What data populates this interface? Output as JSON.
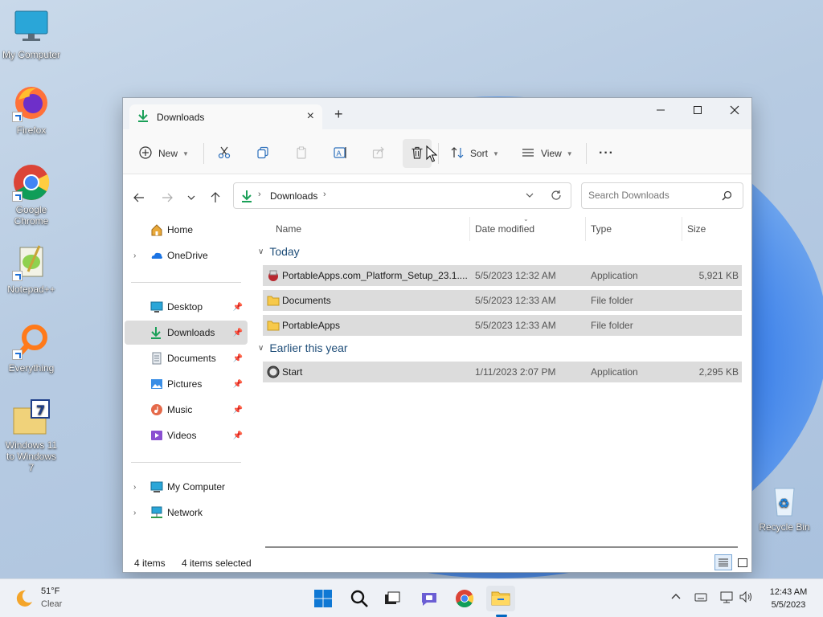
{
  "desktop": {
    "icons": [
      {
        "label": "My Computer"
      },
      {
        "label": "Firefox"
      },
      {
        "label": "Google Chrome"
      },
      {
        "label": "Notepad++"
      },
      {
        "label": "Everything"
      },
      {
        "label": "Windows 11 to Windows 7"
      },
      {
        "label": "Recycle Bin"
      }
    ]
  },
  "window": {
    "tab_title": "Downloads",
    "new_tab": "+",
    "toolbar": {
      "new_label": "New",
      "sort_label": "Sort",
      "view_label": "View",
      "more_label": "···"
    },
    "address": {
      "path": [
        "Downloads"
      ],
      "search_placeholder": "Search Downloads"
    },
    "nav": {
      "items": [
        {
          "label": "Home",
          "icon": "home-icon"
        },
        {
          "label": "OneDrive",
          "icon": "onedrive-icon"
        },
        {
          "label": "Desktop",
          "icon": "desktop-icon",
          "pinned": true
        },
        {
          "label": "Downloads",
          "icon": "downloads-icon",
          "pinned": true,
          "selected": true
        },
        {
          "label": "Documents",
          "icon": "documents-icon",
          "pinned": true
        },
        {
          "label": "Pictures",
          "icon": "pictures-icon",
          "pinned": true
        },
        {
          "label": "Music",
          "icon": "music-icon",
          "pinned": true
        },
        {
          "label": "Videos",
          "icon": "videos-icon",
          "pinned": true
        },
        {
          "label": "My Computer",
          "icon": "computer-icon"
        },
        {
          "label": "Network",
          "icon": "network-icon"
        }
      ]
    },
    "columns": [
      "Name",
      "Date modified",
      "Type",
      "Size"
    ],
    "groups": [
      {
        "label": "Today",
        "files": [
          {
            "name": "PortableApps.com_Platform_Setup_23.1....",
            "date": "5/5/2023 12:32 AM",
            "type": "Application",
            "size": "5,921 KB",
            "icon": "installer-icon"
          },
          {
            "name": "Documents",
            "date": "5/5/2023 12:33 AM",
            "type": "File folder",
            "size": "",
            "icon": "folder-icon"
          },
          {
            "name": "PortableApps",
            "date": "5/5/2023 12:33 AM",
            "type": "File folder",
            "size": "",
            "icon": "folder-icon"
          }
        ]
      },
      {
        "label": "Earlier this year",
        "files": [
          {
            "name": "Start",
            "date": "1/11/2023 2:07 PM",
            "type": "Application",
            "size": "2,295 KB",
            "icon": "start-app-icon"
          }
        ]
      }
    ],
    "status": {
      "item_count": "4 items",
      "selected_count": "4 items selected"
    }
  },
  "taskbar": {
    "weather_temp": "51°F",
    "weather_desc": "Clear",
    "time": "12:43 AM",
    "date": "5/5/2023"
  },
  "colors": {
    "accent": "#0067c0",
    "folder": "#f7c94a",
    "selection": "#dcdcdc",
    "group_header": "#1f4e79"
  }
}
